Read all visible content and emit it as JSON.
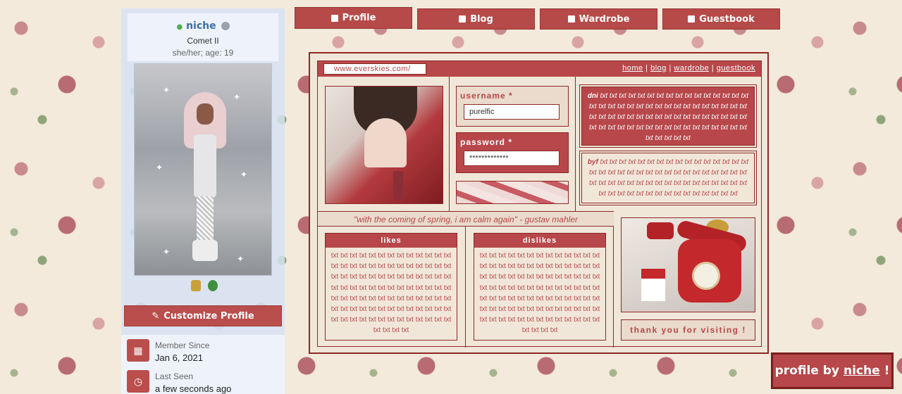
{
  "user": {
    "username": "niche",
    "rank": "Comet II",
    "pronouns": "she/her; age: 19"
  },
  "sidebar": {
    "customize_label": "Customize Profile",
    "stats": [
      {
        "label": "Member Since",
        "value": "Jan 6, 2021",
        "icon": "calendar-icon"
      },
      {
        "label": "Last Seen",
        "value": "a few seconds ago",
        "icon": "clock-calendar-icon"
      }
    ]
  },
  "tabs": [
    {
      "label": "Profile",
      "icon": "profile-card-icon"
    },
    {
      "label": "Blog",
      "icon": "blog-icon"
    },
    {
      "label": "Wardrobe",
      "icon": "wardrobe-icon"
    },
    {
      "label": "Guestbook",
      "icon": "guestbook-icon"
    }
  ],
  "panel": {
    "url": "www.everskies.com/",
    "nav": [
      "home",
      "blog",
      "wardrobe",
      "guestbook"
    ],
    "nav_separator": " | ",
    "login": {
      "username_label": "username *",
      "username_value": "purelfic",
      "password_label": "password *",
      "password_value": "*************"
    },
    "dni_label": "dni",
    "dni_text": "txt txt txt txt txt txt txt txt txt txt txt txt txt txt txt txt txt txt txt txt txt txt txt txt txt txt txt txt txt txt txt txt txt txt txt txt txt txt txt txt txt txt txt txt txt txt txt txt txt txt txt txt txt txt txt txt txt txt txt txt txt txt txt txt txt txt txt txt txt txt txt txt",
    "byf_label": "byf",
    "byf_text": "txt txt txt txt txt txt txt txt txt txt txt txt txt txt txt txt txt txt txt txt txt txt txt txt txt txt txt txt txt txt txt txt txt txt txt txt txt txt txt txt txt txt txt txt txt txt txt txt txt txt txt txt txt txt txt txt txt txt txt txt txt txt txt txt txt",
    "quote": "\"with the coming of spring, i am calm again\" - gustav mahler",
    "likes_title": "likes",
    "likes_text": "txt txt txt txt txt txt txt txt txt txt txt txt txt txt txt txt txt txt txt txt txt txt txt txt txt txt txt txt txt txt txt txt txt txt txt txt txt txt txt txt txt txt txt txt txt txt txt txt txt txt txt txt txt txt txt txt txt txt txt txt txt txt txt txt txt txt txt txt txt txt txt txt txt txt txt txt txt txt txt txt txt txt txt txt txt txt txt txt txt txt txt txt txt txt txt",
    "dislikes_title": "dislikes",
    "dislikes_text": "txt txt txt txt txt txt txt txt txt txt txt txt txt txt txt txt txt txt txt txt txt txt txt txt txt txt txt txt txt txt txt txt txt txt txt txt txt txt txt txt txt txt txt txt txt txt txt txt txt txt txt txt txt txt txt txt txt txt txt txt txt txt txt txt txt txt txt txt txt txt txt txt txt txt txt txt txt txt txt txt txt txt txt txt txt txt txt txt txt txt txt txt txt txt txt",
    "thanks": "thank you for visiting !"
  },
  "credit": {
    "prefix": "profile by",
    "link": "niche",
    "suffix": "!"
  },
  "colors": {
    "accent": "#b7474a",
    "dark_red": "#8e2826",
    "cream": "#f1e7d9",
    "sidebar_blue": "#d6e2f3",
    "username_blue": "#3a6ea8"
  }
}
